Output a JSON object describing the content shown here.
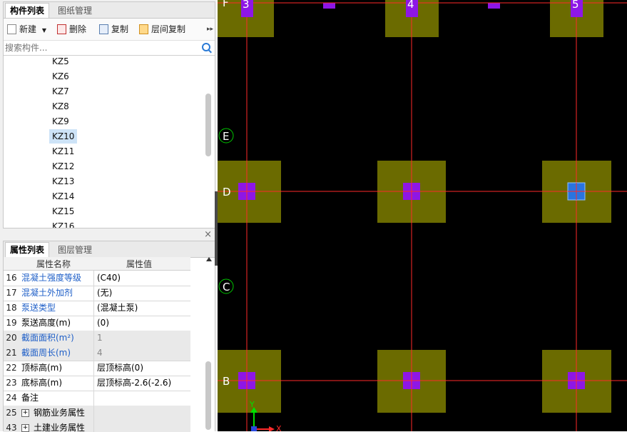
{
  "component_panel": {
    "tabs": [
      "构件列表",
      "图纸管理"
    ],
    "toolbar": {
      "new": "新建",
      "delete": "删除",
      "copy": "复制",
      "layer_copy": "层间复制",
      "more": "▸▸"
    },
    "search_placeholder": "搜索构件...",
    "items": [
      "KZ5",
      "KZ6",
      "KZ7",
      "KZ8",
      "KZ9",
      "KZ10",
      "KZ11",
      "KZ12",
      "KZ13",
      "KZ14",
      "KZ15",
      "KZ16"
    ],
    "selected": "KZ10"
  },
  "property_panel": {
    "close": "×",
    "tabs": [
      "属性列表",
      "图层管理"
    ],
    "headers": {
      "name": "属性名称",
      "value": "属性值"
    },
    "rows": [
      {
        "num": "16",
        "name": "混凝土强度等级",
        "value": "(C40)"
      },
      {
        "num": "17",
        "name": "混凝土外加剂",
        "value": "(无)"
      },
      {
        "num": "18",
        "name": "泵送类型",
        "value": "(混凝土泵)"
      },
      {
        "num": "19",
        "name": "泵送高度(m)",
        "value": "(0)"
      },
      {
        "num": "20",
        "name": "截面面积(m²)",
        "value": "1"
      },
      {
        "num": "21",
        "name": "截面周长(m)",
        "value": "4"
      },
      {
        "num": "22",
        "name": "顶标高(m)",
        "value": "层顶标高(0)"
      },
      {
        "num": "23",
        "name": "底标高(m)",
        "value": "层顶标高-2.6(-2.6)"
      },
      {
        "num": "24",
        "name": "备注",
        "value": ""
      },
      {
        "num": "25",
        "name": "钢筋业务属性",
        "value": ""
      },
      {
        "num": "43",
        "name": "土建业务属性",
        "value": ""
      }
    ]
  },
  "canvas": {
    "column_axis_labels": [
      "3",
      "4",
      "5"
    ],
    "row_axis_labels": [
      "F",
      "E",
      "D",
      "C",
      "B"
    ],
    "ucs": {
      "y": "Y",
      "x": "X"
    },
    "colors": {
      "background": "#000000",
      "axis": "#ff2a2a",
      "footing": "#6b6b00",
      "column": "#8e16e6",
      "selected_column": "#2a74e0",
      "axis_bubble": "#00c800"
    }
  }
}
